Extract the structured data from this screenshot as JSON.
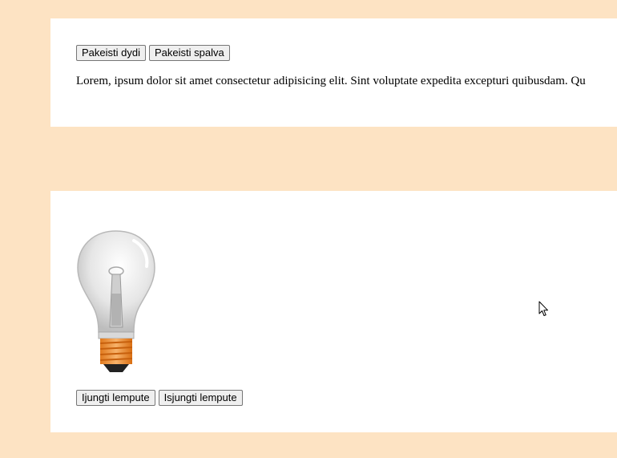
{
  "section_text": {
    "buttons": {
      "change_size": "Pakeisti dydi",
      "change_color": "Pakeisti spalva"
    },
    "paragraph": "Lorem, ipsum dolor sit amet consectetur adipisicing elit. Sint voluptate expedita excepturi quibusdam. Qu"
  },
  "section_bulb": {
    "image_icon": "lightbulb-icon",
    "buttons": {
      "turn_on": "Ijungti lempute",
      "turn_off": "Isjungti lempute"
    }
  },
  "colors": {
    "page_background": "#fde3c3",
    "panel_background": "#ffffff",
    "bulb_base": "#f5a04a"
  },
  "cursor_icon": "mouse-pointer-icon"
}
